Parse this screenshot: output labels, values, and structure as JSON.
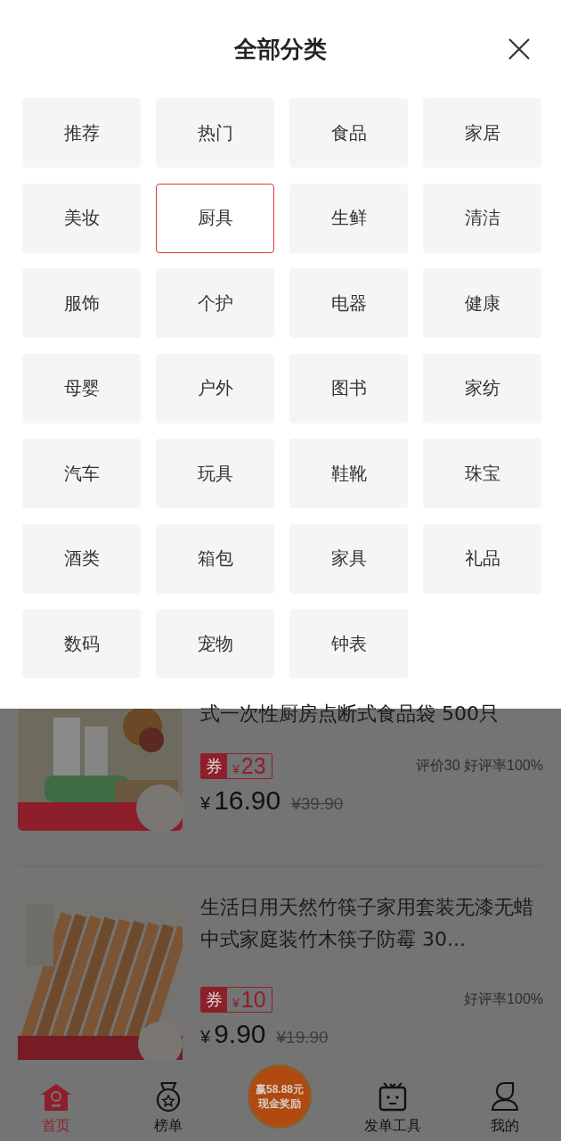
{
  "panel": {
    "title": "全部分类",
    "categories": [
      {
        "label": "推荐",
        "selected": false
      },
      {
        "label": "热门",
        "selected": false
      },
      {
        "label": "食品",
        "selected": false
      },
      {
        "label": "家居",
        "selected": false
      },
      {
        "label": "美妆",
        "selected": false
      },
      {
        "label": "厨具",
        "selected": true
      },
      {
        "label": "生鲜",
        "selected": false
      },
      {
        "label": "清洁",
        "selected": false
      },
      {
        "label": "服饰",
        "selected": false
      },
      {
        "label": "个护",
        "selected": false
      },
      {
        "label": "电器",
        "selected": false
      },
      {
        "label": "健康",
        "selected": false
      },
      {
        "label": "母婴",
        "selected": false
      },
      {
        "label": "户外",
        "selected": false
      },
      {
        "label": "图书",
        "selected": false
      },
      {
        "label": "家纺",
        "selected": false
      },
      {
        "label": "汽车",
        "selected": false
      },
      {
        "label": "玩具",
        "selected": false
      },
      {
        "label": "鞋靴",
        "selected": false
      },
      {
        "label": "珠宝",
        "selected": false
      },
      {
        "label": "酒类",
        "selected": false
      },
      {
        "label": "箱包",
        "selected": false
      },
      {
        "label": "家具",
        "selected": false
      },
      {
        "label": "礼品",
        "selected": false
      },
      {
        "label": "数码",
        "selected": false
      },
      {
        "label": "宠物",
        "selected": false
      },
      {
        "label": "钟表",
        "selected": false
      }
    ]
  },
  "products": [
    {
      "title": "式一次性厨房点断式食品袋 500只",
      "coupon_mark": "券",
      "coupon_currency": "¥",
      "coupon": "23",
      "rating": "评价30 好评率100%",
      "currency": "¥",
      "price": "16.90",
      "original_price": "¥39.90"
    },
    {
      "title": "生活日用天然竹筷子家用套装无漆无蜡中式家庭装竹木筷子防霉 30...",
      "coupon_mark": "券",
      "coupon_currency": "¥",
      "coupon": "10",
      "rating": "好评率100%",
      "currency": "¥",
      "price": "9.90",
      "original_price": "¥19.90"
    }
  ],
  "nav": {
    "items": [
      {
        "label": "首页",
        "selected": true
      },
      {
        "label": "榜单",
        "selected": false
      },
      {
        "label": "发单工具",
        "selected": false
      },
      {
        "label": "我的",
        "selected": false
      }
    ],
    "promo": [
      "赢58.88元",
      "现金奖励"
    ]
  }
}
